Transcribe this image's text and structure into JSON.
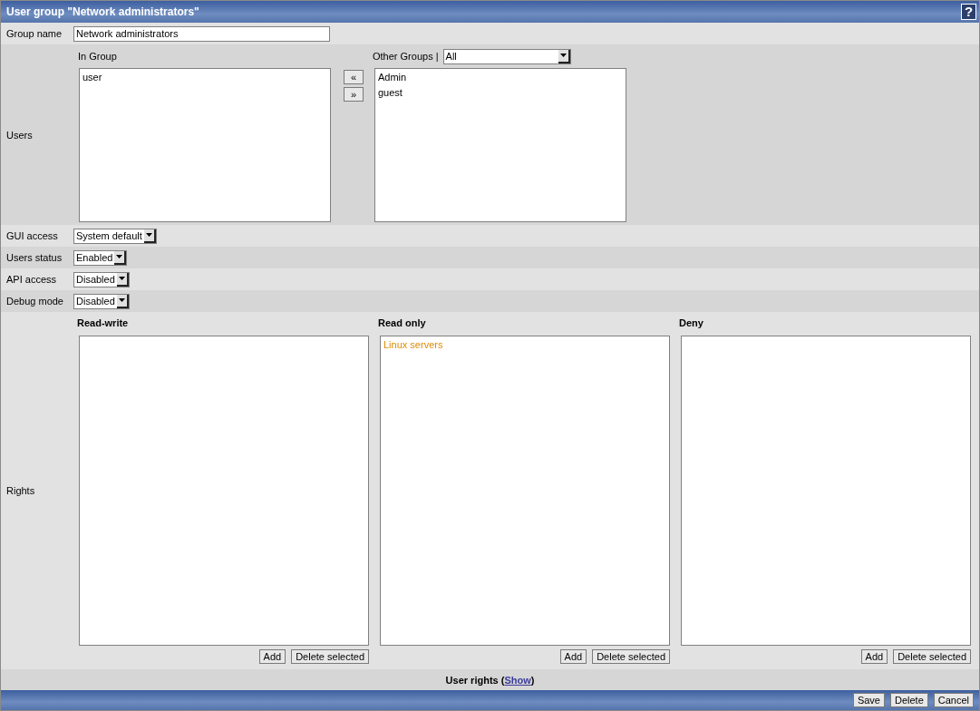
{
  "window": {
    "title": "User group \"Network administrators\"",
    "help": "?"
  },
  "group_name": {
    "label": "Group name",
    "value": "Network administrators"
  },
  "users": {
    "label": "Users",
    "in_group": {
      "heading": "In Group",
      "items": [
        {
          "label": "user",
          "selected": false
        }
      ]
    },
    "move_buttons": [
      "«",
      "»"
    ],
    "other_groups": {
      "heading": "Other Groups |",
      "filter": "All",
      "items": [
        {
          "label": "Admin",
          "selected": false
        },
        {
          "label": "guest",
          "selected": false
        }
      ]
    }
  },
  "settings": [
    {
      "label": "GUI access",
      "value": "System default"
    },
    {
      "label": "Users status",
      "value": "Enabled"
    },
    {
      "label": "API access",
      "value": "Disabled"
    },
    {
      "label": "Debug mode",
      "value": "Disabled"
    }
  ],
  "rights": {
    "label": "Rights",
    "columns": [
      {
        "heading": "Read-write",
        "buttons": [
          "Add",
          "Delete selected"
        ]
      },
      {
        "heading": "Read only",
        "items": [
          {
            "label": "Linux servers",
            "color": "#e08a00"
          }
        ],
        "buttons": [
          "Add",
          "Delete selected"
        ]
      },
      {
        "heading": "Deny",
        "buttons": [
          "Add",
          "Delete selected"
        ]
      }
    ]
  },
  "user_rights": {
    "prefix": "User rights (",
    "link": "Show",
    "suffix": ")"
  },
  "footer_buttons": [
    "Save",
    "Delete",
    "Cancel"
  ]
}
